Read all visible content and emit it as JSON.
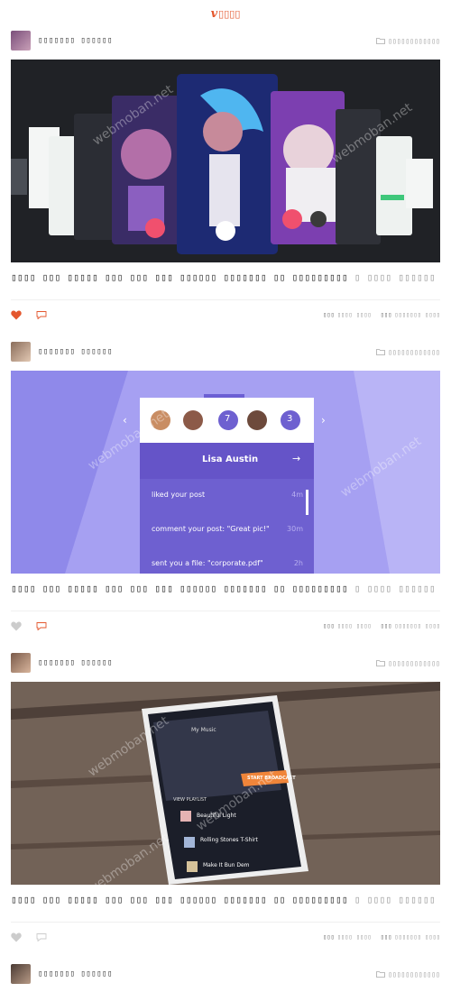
{
  "header": {
    "logo_mark": "v",
    "logo_text": "▯▯▯▯"
  },
  "posts": [
    {
      "author": "▯▯▯▯▯▯▯ ▯▯▯▯▯▯",
      "category": "▯▯▯▯▯▯▯▯▯▯▯▯",
      "title": "▯▯▯▯ ▯▯▯ ▯▯▯▯▯ ▯▯▯ ▯▯▯ ▯▯▯ ▯▯▯▯▯▯ ▯▯▯▯▯▯▯ ▯▯ ▯▯▯▯▯▯▯▯▯",
      "subtitle": "▯ ▯▯▯▯ ▯▯▯▯▯▯",
      "liked": true,
      "meta1_label": "▯▯▯",
      "meta1_value": "▯▯▯▯ ▯▯▯▯",
      "meta2_label": "▯▯▯",
      "meta2_value": "▯▯▯▯▯▯▯ ▯▯▯▯"
    },
    {
      "author": "▯▯▯▯▯▯▯ ▯▯▯▯▯▯",
      "category": "▯▯▯▯▯▯▯▯▯▯▯▯",
      "title": "▯▯▯▯ ▯▯▯ ▯▯▯▯▯ ▯▯▯ ▯▯▯ ▯▯▯ ▯▯▯▯▯▯ ▯▯▯▯▯▯▯ ▯▯ ▯▯▯▯▯▯▯▯▯",
      "subtitle": "▯ ▯▯▯▯ ▯▯▯▯▯▯",
      "liked": false,
      "meta1_label": "▯▯▯",
      "meta1_value": "▯▯▯▯ ▯▯▯▯",
      "meta2_label": "▯▯▯",
      "meta2_value": "▯▯▯▯▯▯▯ ▯▯▯▯",
      "mock": {
        "badge1": "7",
        "badge2": "3",
        "name": "Lisa Austin",
        "items": [
          {
            "text": "liked your post",
            "time": "4m"
          },
          {
            "text": "comment your post: \"Great pic!\"",
            "time": "30m"
          },
          {
            "text": "sent you a file: \"corporate.pdf\"",
            "time": "2h"
          }
        ]
      }
    },
    {
      "author": "▯▯▯▯▯▯▯ ▯▯▯▯▯▯",
      "category": "▯▯▯▯▯▯▯▯▯▯▯▯",
      "title": "▯▯▯▯ ▯▯▯ ▯▯▯▯▯ ▯▯▯ ▯▯▯ ▯▯▯ ▯▯▯▯▯▯ ▯▯▯▯▯▯▯ ▯▯ ▯▯▯▯▯▯▯▯▯",
      "subtitle": "▯ ▯▯▯▯ ▯▯▯▯▯▯",
      "liked": false,
      "meta1_label": "▯▯▯",
      "meta1_value": "▯▯▯▯ ▯▯▯▯",
      "meta2_label": "▯▯▯",
      "meta2_value": "▯▯▯▯▯▯▯ ▯▯▯▯",
      "mock": {
        "app_title": "My Music",
        "button": "START BROADCAST",
        "playlist": "VIEW PLAYLIST",
        "tracks": [
          "Beautiful Light",
          "Rolling Stones T-Shirt",
          "Make It Bun Dem"
        ]
      }
    },
    {
      "author": "▯▯▯▯▯▯▯ ▯▯▯▯▯▯",
      "category": "▯▯▯▯▯▯▯▯▯▯▯▯"
    }
  ],
  "watermark": "webmoban.net",
  "colors": {
    "accent": "#e4572e",
    "like_active": "#e4572e",
    "like_inactive": "#cccccc"
  }
}
